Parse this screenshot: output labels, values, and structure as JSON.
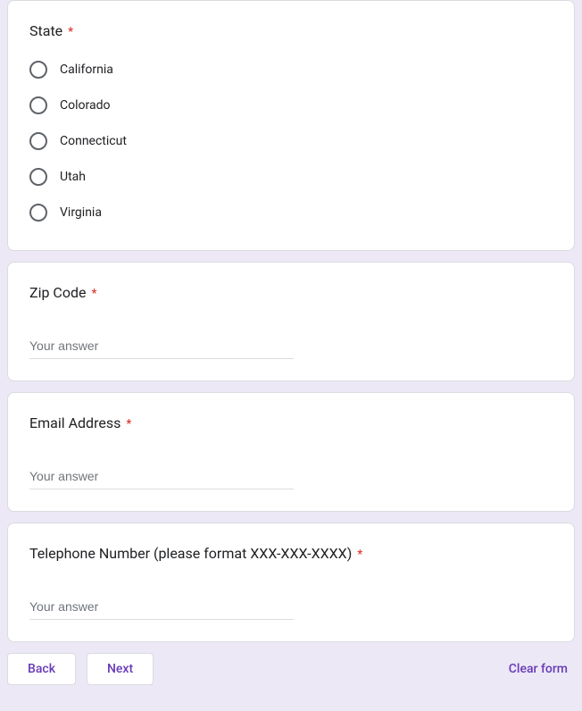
{
  "required_marker": "*",
  "questions": {
    "state": {
      "label": "State",
      "options": [
        "California",
        "Colorado",
        "Connecticut",
        "Utah",
        "Virginia"
      ]
    },
    "zip": {
      "label": "Zip Code",
      "placeholder": "Your answer"
    },
    "email": {
      "label": "Email Address",
      "placeholder": "Your answer"
    },
    "phone": {
      "label": "Telephone Number (please format XXX-XXX-XXXX)",
      "placeholder": "Your answer"
    }
  },
  "footer": {
    "back": "Back",
    "next": "Next",
    "clear": "Clear form"
  }
}
